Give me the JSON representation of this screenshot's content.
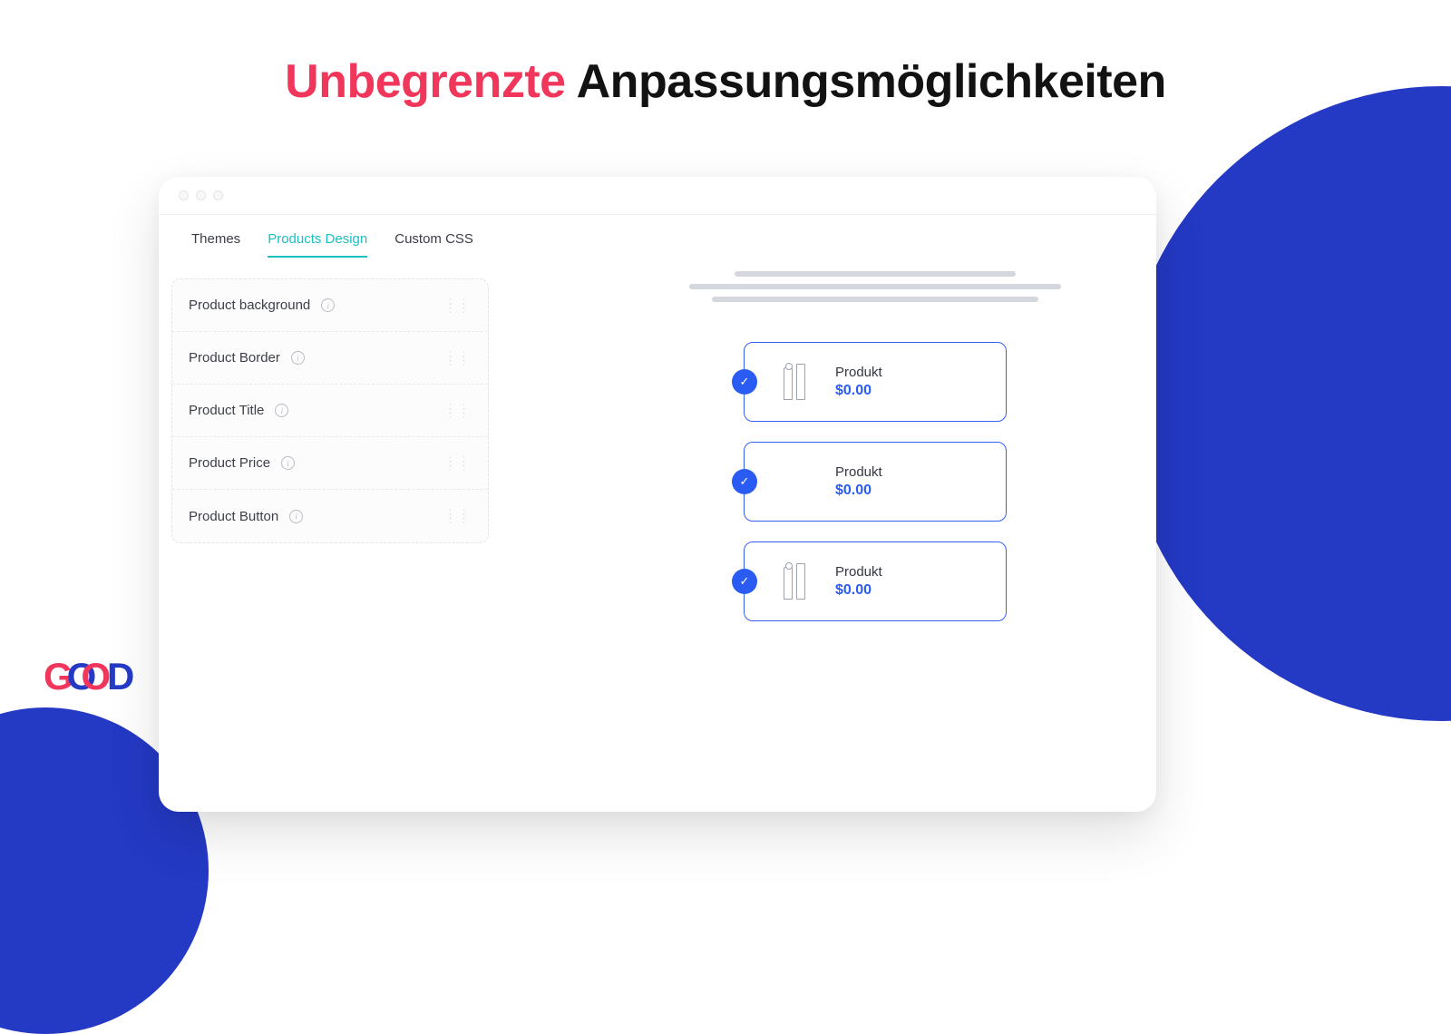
{
  "heading": {
    "highlight": "Unbegrenzte",
    "rest": "Anpassungsmöglichkeiten"
  },
  "tabs": [
    {
      "label": "Themes",
      "active": false
    },
    {
      "label": "Products Design",
      "active": true
    },
    {
      "label": "Custom CSS",
      "active": false
    }
  ],
  "designOptions": [
    {
      "label": "Product background"
    },
    {
      "label": "Product Border"
    },
    {
      "label": "Product Title"
    },
    {
      "label": "Product Price"
    },
    {
      "label": "Product Button"
    }
  ],
  "products": [
    {
      "title": "Produkt",
      "price": "$0.00"
    },
    {
      "title": "Produkt",
      "price": "$0.00"
    },
    {
      "title": "Produkt",
      "price": "$0.00"
    }
  ],
  "logo": {
    "text": "GOOD"
  },
  "colors": {
    "accent": "#2439c4",
    "pink": "#f1365c",
    "link": "#2a5cf3",
    "teal": "#1abfc0"
  }
}
